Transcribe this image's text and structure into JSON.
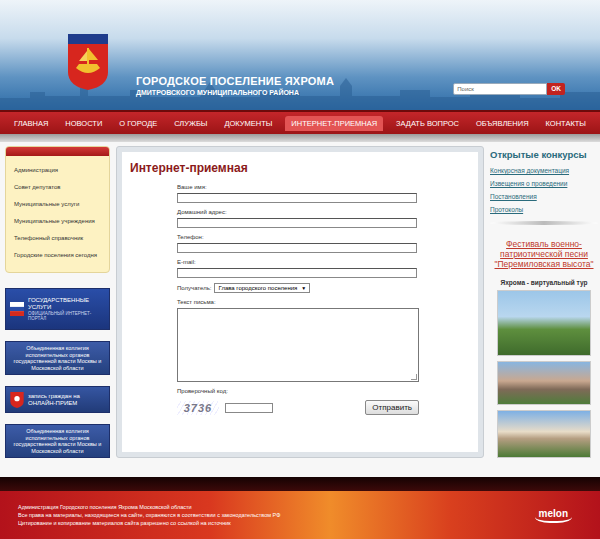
{
  "header": {
    "title": "ГОРОДСКОЕ ПОСЕЛЕНИЕ ЯХРОМА",
    "subtitle": "ДМИТРОВСКОГО МУНИЦИПАЛЬНОГО РАЙОНА",
    "search": {
      "placeholder": "Поиск",
      "button": "OK"
    }
  },
  "nav": [
    {
      "label": "ГЛАВНАЯ",
      "selected": false
    },
    {
      "label": "НОВОСТИ",
      "selected": false
    },
    {
      "label": "О ГОРОДЕ",
      "selected": false
    },
    {
      "label": "СЛУЖБЫ",
      "selected": false
    },
    {
      "label": "ДОКУМЕНТЫ",
      "selected": false
    },
    {
      "label": "ИНТЕРНЕТ-ПРИЕМНАЯ",
      "selected": true
    },
    {
      "label": "ЗАДАТЬ ВОПРОС",
      "selected": false
    },
    {
      "label": "ОБЪЯВЛЕНИЯ",
      "selected": false
    },
    {
      "label": "КОНТАКТЫ",
      "selected": false
    }
  ],
  "sidebar": {
    "items": [
      "Администрация",
      "Совет депутатов",
      "Муниципальные услуги",
      "Муниципальные учреждения",
      "Телефонный справочник",
      "Городские поселения сегодня"
    ],
    "banners": [
      {
        "kind": "gosuslugi",
        "title": "ГОСУДАРСТВЕННЫЕ УСЛУГИ",
        "subtitle": "ОФИЦИАЛЬНЫЙ ИНТЕРНЕТ-ПОРТАЛ"
      },
      {
        "kind": "collegium",
        "title": "Объединенная коллегия исполнительных органов государственной власти Москвы и Московской области",
        "subtitle": ""
      },
      {
        "kind": "online",
        "title": "запись граждан на ОНЛАЙН-ПРИЕМ",
        "subtitle": ""
      },
      {
        "kind": "collegium",
        "title": "Объединенная коллегия исполнительных органов государственной власти Москвы и Московской области",
        "subtitle": ""
      }
    ]
  },
  "form": {
    "title": "Интернет-приемная",
    "fields": [
      {
        "label": "Ваше имя:",
        "kind": "input"
      },
      {
        "label": "Домашний адрес:",
        "kind": "input"
      },
      {
        "label": "Телефон:",
        "kind": "input"
      },
      {
        "label": "E-mail:",
        "kind": "input"
      },
      {
        "label": "Получатель:",
        "kind": "select",
        "value": "Глава городского поселения",
        "arrow": "▼"
      },
      {
        "label": "Текст письма:",
        "kind": "textarea"
      }
    ],
    "captcha": {
      "label": "Проверочный код:",
      "code": "3736"
    },
    "submit": "Отправить"
  },
  "right": {
    "contests_title": "Открытые конкурсы",
    "contests": [
      "Конкурсная документация",
      "Извещения о проведении",
      "Постановления",
      "Протоколы"
    ],
    "festival": "Фестиваль военно-патриотической песни \"Перемиловская высота\"",
    "tour_title": "Яхрома - виртуальный тур"
  },
  "footer": {
    "lines": [
      "Администрация Городского поселения Яхрома Московской области",
      "Все права на материалы, находящиеся на сайте, охраняются в соответствии с законодательством РФ",
      "Цитирование и копирование материалов сайта разрешено со ссылкой на источник"
    ],
    "brand": "melon"
  }
}
